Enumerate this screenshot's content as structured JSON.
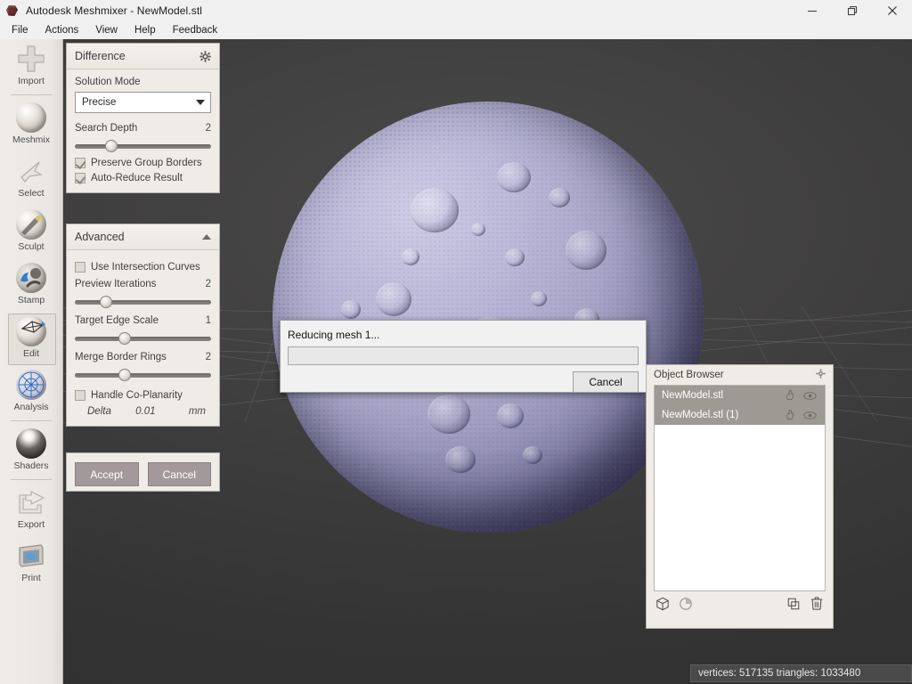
{
  "window": {
    "title": "Autodesk Meshmixer - NewModel.stl",
    "logo_icon": "meshmixer-logo-icon",
    "controls": [
      {
        "name": "minimize",
        "icon": "minimize-icon"
      },
      {
        "name": "restore",
        "icon": "restore-icon"
      },
      {
        "name": "close",
        "icon": "close-icon"
      }
    ]
  },
  "menubar": {
    "items": [
      "File",
      "Actions",
      "View",
      "Help",
      "Feedback"
    ]
  },
  "toolrail": {
    "items": [
      {
        "label": "Import",
        "icon": "plus-icon",
        "active": false
      },
      {
        "label": "Meshmix",
        "icon": "face-sphere-icon",
        "active": false
      },
      {
        "label": "Select",
        "icon": "cursor-arrow-icon",
        "active": false
      },
      {
        "label": "Sculpt",
        "icon": "brush-sphere-icon",
        "active": false
      },
      {
        "label": "Stamp",
        "icon": "stamp-icon",
        "active": false
      },
      {
        "label": "Edit",
        "icon": "edit-sphere-icon",
        "active": true
      },
      {
        "label": "Analysis",
        "icon": "wireframe-sphere-icon",
        "active": false
      },
      {
        "label": "Shaders",
        "icon": "shaded-sphere-icon",
        "active": false
      },
      {
        "label": "Export",
        "icon": "export-arrow-icon",
        "active": false
      },
      {
        "label": "Print",
        "icon": "printer-icon",
        "active": false
      }
    ]
  },
  "difference_panel": {
    "title": "Difference",
    "settings_icon": "gear-icon",
    "solution_mode": {
      "label": "Solution Mode",
      "value": "Precise",
      "caret_icon": "chevron-down-icon"
    },
    "search_depth": {
      "label": "Search Depth",
      "value": "2",
      "knob_percent": 22
    },
    "checkboxes": [
      {
        "label": "Preserve Group Borders",
        "checked": true
      },
      {
        "label": "Auto-Reduce Result",
        "checked": true
      }
    ],
    "advanced": {
      "title": "Advanced",
      "collapse_icon": "triangle-up-icon",
      "use_intersection_curves": {
        "label": "Use Intersection Curves",
        "checked": false
      },
      "sliders": [
        {
          "label": "Preview Iterations",
          "value": "2",
          "knob_percent": 18
        },
        {
          "label": "Target Edge Scale",
          "value": "1",
          "knob_percent": 32
        },
        {
          "label": "Merge Border Rings",
          "value": "2",
          "knob_percent": 32
        }
      ],
      "handle_co_planarity": {
        "label": "Handle Co-Planarity",
        "checked": false
      },
      "delta": {
        "label": "Delta",
        "value": "0.01",
        "unit": "mm"
      }
    },
    "accept_label": "Accept",
    "cancel_label": "Cancel"
  },
  "progress_dialog": {
    "message": "Reducing mesh 1...",
    "progress_percent": 0,
    "cancel_label": "Cancel"
  },
  "object_browser": {
    "title": "Object Browser",
    "settings_icon": "gear-icon",
    "rows": [
      {
        "name": "NewModel.stl",
        "selected": true,
        "pick_icon": "hand-pick-icon",
        "visibility_icon": "eye-icon"
      },
      {
        "name": "NewModel.stl (1)",
        "selected": true,
        "pick_icon": "hand-pick-icon",
        "visibility_icon": "eye-icon"
      }
    ],
    "footer_icons": [
      {
        "name": "cube-icon",
        "side": "left"
      },
      {
        "name": "pie-chart-icon",
        "side": "left"
      },
      {
        "name": "duplicate-icon",
        "side": "right"
      },
      {
        "name": "trash-icon",
        "side": "right"
      }
    ]
  },
  "statusbar": {
    "text": "vertices: 517135 triangles: 1033480"
  },
  "viewport": {
    "model_name": "cratered-sphere-model",
    "background_color": "#3a3a3a",
    "model_color": "#a9a6c8",
    "grid_color": "#8a8a8a"
  }
}
